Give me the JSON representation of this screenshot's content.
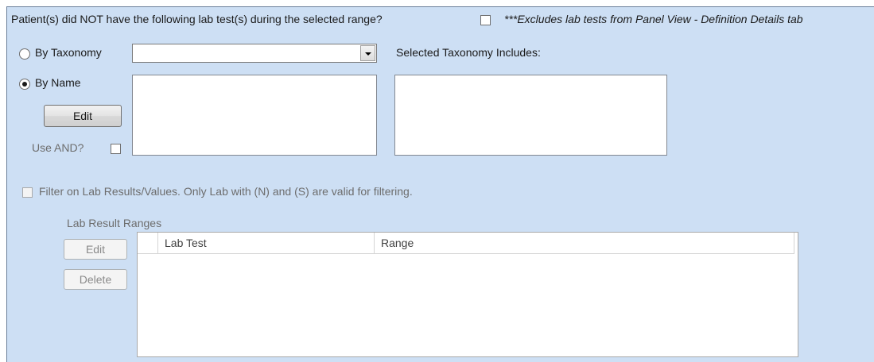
{
  "header": {
    "question": "Patient(s) did NOT have the following lab test(s) during the selected range?",
    "note": "***Excludes lab tests from Panel View - Definition Details tab"
  },
  "taxonomy": {
    "radio_label": "By Taxonomy",
    "selected_value": "",
    "includes_label": "Selected Taxonomy Includes:"
  },
  "by_name": {
    "radio_label": "By Name",
    "edit_label": "Edit",
    "use_and_label": "Use AND?"
  },
  "filter": {
    "label": "Filter on Lab Results/Values.  Only Lab with (N) and (S) are valid for filtering."
  },
  "ranges": {
    "group_label": "Lab Result Ranges",
    "edit_label": "Edit",
    "delete_label": "Delete",
    "columns": [
      "Lab Test",
      "Range"
    ]
  }
}
